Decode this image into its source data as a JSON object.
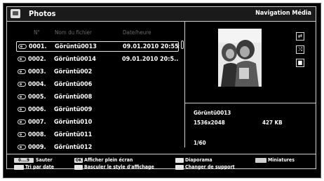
{
  "header": {
    "title": "Photos",
    "section": "Navigation Média"
  },
  "columns": {
    "number": "N°",
    "filename": "Nom du fichier",
    "date": "Date/heure"
  },
  "files": [
    {
      "num": "0001.",
      "name": "Görüntü0013",
      "date": "09.01.2010 20:55:"
    },
    {
      "num": "0002.",
      "name": "Görüntü0014",
      "date": "09.01.2010 20:5..."
    },
    {
      "num": "0003.",
      "name": "Görüntü002",
      "date": ""
    },
    {
      "num": "0004.",
      "name": "Görüntü006",
      "date": ""
    },
    {
      "num": "0005.",
      "name": "Görüntü008",
      "date": ""
    },
    {
      "num": "0006.",
      "name": "Görüntü009",
      "date": ""
    },
    {
      "num": "0007.",
      "name": "Görüntü010",
      "date": ""
    },
    {
      "num": "0008.",
      "name": "Görüntü011",
      "date": ""
    },
    {
      "num": "0009.",
      "name": "Görüntü012",
      "date": ""
    }
  ],
  "preview": {
    "filename": "Görüntü0013",
    "resolution": "1536x2048",
    "size": "427 KB",
    "position": "1/60"
  },
  "controls": [
    "repeat-icon",
    "shuffle-icon",
    "stop-icon"
  ],
  "legend": {
    "digits_key": "0....9",
    "skip": "Sauter",
    "sort_by_date": "Tri par date",
    "ok_key": "OK",
    "fullscreen": "Afficher plein écran",
    "toggle_style": "Basculer le style d'affichage",
    "slideshow": "Diaporama",
    "change_source": "Changer de support",
    "thumbnails": "Miniatures"
  },
  "colors": {
    "background": "#000000",
    "text": "#ffffff",
    "header_text": "#6b6b6b",
    "border": "#cfcfcf"
  }
}
